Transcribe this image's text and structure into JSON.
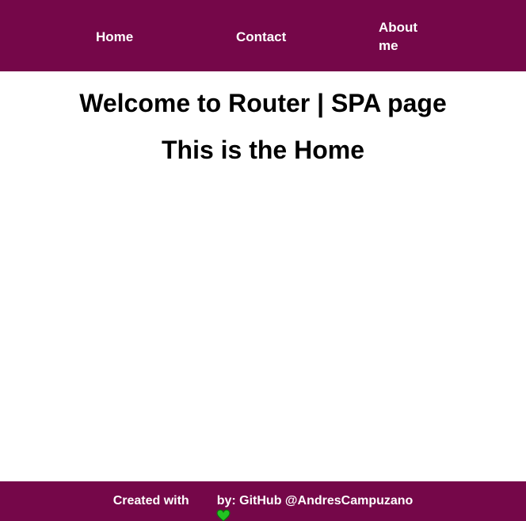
{
  "nav": {
    "items": [
      {
        "label": "Home"
      },
      {
        "label": "Contact"
      },
      {
        "label": "About me"
      }
    ]
  },
  "main": {
    "welcome_title": "Welcome to Router | SPA page",
    "page_title": "This is the Home"
  },
  "footer": {
    "prefix": "Created with",
    "icon": "green-heart-icon",
    "suffix": "by: GitHub @AndresCampuzano"
  },
  "colors": {
    "header_bg": "#750749",
    "footer_bg": "#750749",
    "nav_text": "#ffffff",
    "heading_text": "#000000",
    "heart": "#22c422"
  }
}
